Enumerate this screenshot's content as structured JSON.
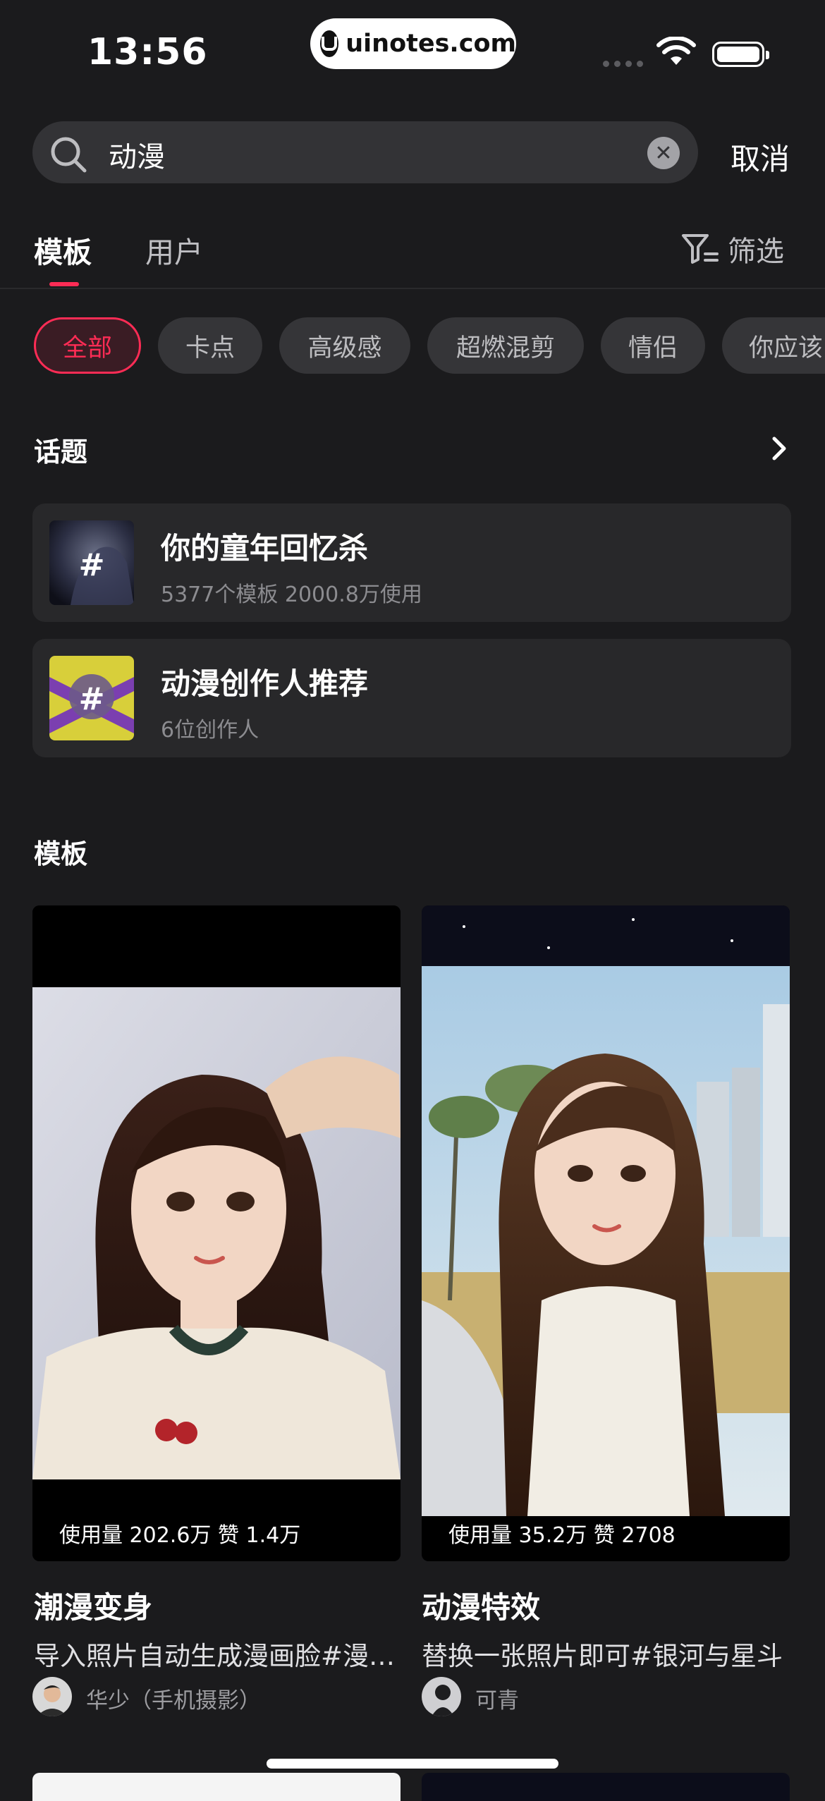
{
  "status_bar": {
    "time": "13:56",
    "watermark": "uinotes.com"
  },
  "search": {
    "query": "动漫",
    "cancel_label": "取消"
  },
  "tabs": [
    {
      "label": "模板"
    },
    {
      "label": "用户"
    }
  ],
  "filter_label": "筛选",
  "chips": [
    {
      "label": "全部"
    },
    {
      "label": "卡点"
    },
    {
      "label": "高级感"
    },
    {
      "label": "超燃混剪"
    },
    {
      "label": "情侣"
    },
    {
      "label": "你应该"
    }
  ],
  "topics_section": {
    "title": "话题"
  },
  "topics": [
    {
      "title": "你的童年回忆杀",
      "subtitle": "5377个模板 2000.8万使用",
      "icon": "hashtag-icon"
    },
    {
      "title": "动漫创作人推荐",
      "subtitle": "6位创作人",
      "icon": "hashtag-icon"
    }
  ],
  "templates_section": {
    "title": "模板"
  },
  "templates": [
    {
      "stats": "使用量 202.6万 赞 1.4万",
      "title": "潮漫变身",
      "desc": "导入照片自动生成漫画脸#漫…",
      "author": "华少（手机摄影）"
    },
    {
      "stats": "使用量 35.2万 赞 2708",
      "title": "动漫特效",
      "desc": "替换一张照片即可#银河与星斗",
      "author": "可青"
    }
  ],
  "colors": {
    "accent": "#fe2c55",
    "background": "#1b1b1d",
    "surface": "#28282a"
  }
}
